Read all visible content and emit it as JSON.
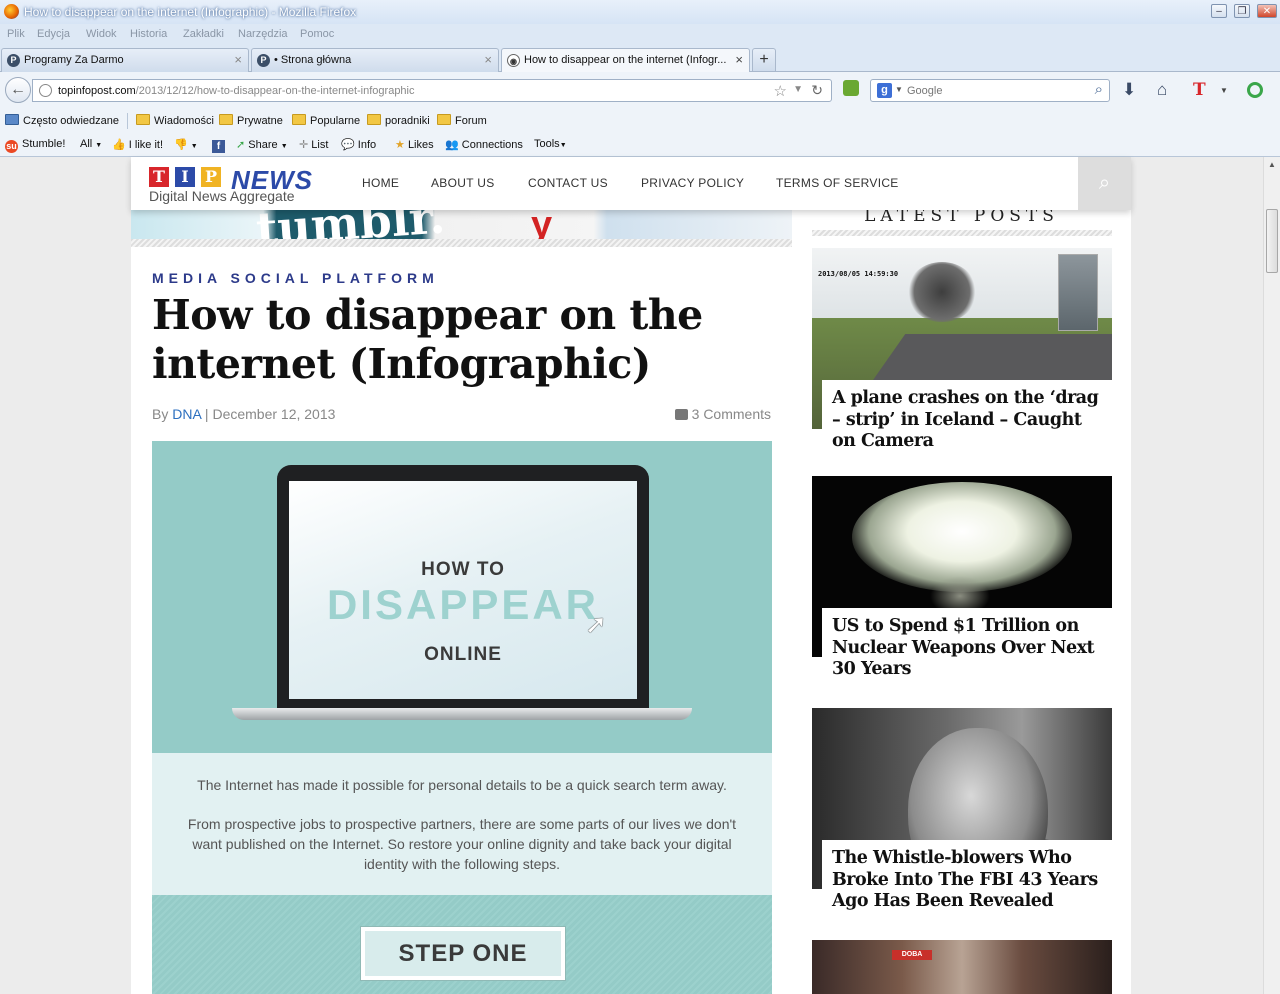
{
  "browser": {
    "window_title": "How to disappear on the internet (Infographic) - Mozilla Firefox",
    "menu": [
      "Plik",
      "Edycja",
      "Widok",
      "Historia",
      "Zakładki",
      "Narzędzia",
      "Pomoc"
    ],
    "tabs": [
      {
        "label": "Programy Za Darmo"
      },
      {
        "label": "• Strona główna"
      },
      {
        "label": "How to disappear on the internet (Infogr..."
      }
    ],
    "url_domain": "topinfopost.com",
    "url_path": "/2013/12/12/how-to-disappear-on-the-internet-infographic",
    "search_placeholder": "Google",
    "bookmarks": [
      "Często odwiedzane",
      "Wiadomości",
      "Prywatne",
      "Popularne",
      "poradniki",
      "Forum"
    ],
    "stumble": {
      "stumble": "Stumble!",
      "all": "All",
      "ilike": "I like it!",
      "share": "Share",
      "list": "List",
      "info": "Info",
      "likes": "Likes",
      "connections": "Connections",
      "tools": "Tools"
    }
  },
  "site": {
    "logo_letters": [
      "T",
      "I",
      "P"
    ],
    "logo_news": "NEWS",
    "logo_tagline": "Digital News Aggregate",
    "nav": [
      "HOME",
      "ABOUT US",
      "CONTACT US",
      "PRIVACY POLICY",
      "TERMS OF SERVICE"
    ],
    "hero_words": {
      "tumblr": "tumblr.",
      "yelp": "y"
    }
  },
  "article": {
    "category": "MEDIA SOCIAL PLATFORM",
    "title": "How to disappear on the internet (Infographic)",
    "by": "By",
    "author": "DNA",
    "sep": " | ",
    "date": "December 12, 2013",
    "comments": "3 Comments",
    "infographic": {
      "howto": "HOW TO",
      "disappear": "DISAPPEAR",
      "online": "ONLINE",
      "text1": "The Internet has made it possible for personal details to be a quick search term away.",
      "text2": "From prospective jobs to prospective partners, there are some parts of our lives we don't want published on the Internet.  So restore your online dignity and take back your digital identity with the following steps.",
      "step": "STEP ONE"
    }
  },
  "sidebar": {
    "title": "LATEST POSTS",
    "posts": [
      {
        "title": "A plane crashes on the ‘drag – strip’ in Iceland – Caught on Camera",
        "timestamp": "2013/08/05 14:59:30"
      },
      {
        "title": "US to Spend $1 Trillion on Nuclear Weapons Over Next 30 Years"
      },
      {
        "title": "The Whistle-blowers Who Broke Into The FBI 43 Years Ago Has Been Revealed"
      },
      {
        "sign": "DOBA"
      }
    ]
  },
  "colors": {
    "nav_accent": "#2c3a8a",
    "author_link": "#2c6fbf",
    "infographic_teal": "#94cbc7",
    "logo_red": "#d8262b",
    "logo_blue": "#2c4aa8",
    "logo_yellow": "#f0b323"
  }
}
